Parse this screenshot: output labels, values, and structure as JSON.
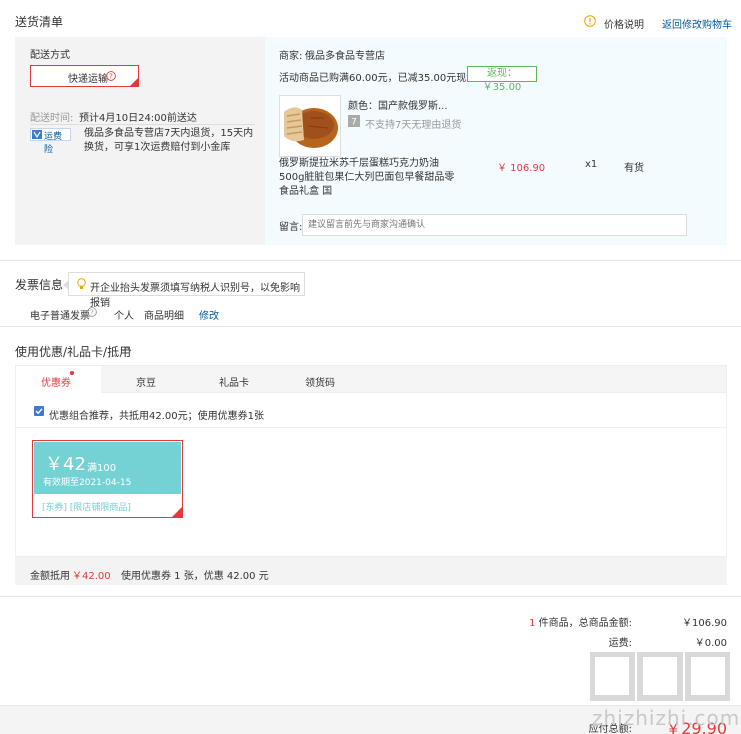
{
  "delivery": {
    "title": "送货清单",
    "price_help": "价格说明",
    "back_cart": "返回修改购物车",
    "method_label": "配送方式",
    "method_value": "快递运输",
    "time_label": "配送时间:",
    "time_value": "预计4月10日24:00前送达",
    "insurance_label": "运费险",
    "insurance_text": "俄品多食品专营店7天内退货，15天内换货，可享1次运费赔付到小金库"
  },
  "shop": {
    "label": "商家:",
    "name": "俄品多食品专营店",
    "promo_text": "活动商品已购满60.00元，已减35.00元现金",
    "promo_badge": "返现：￥35.00",
    "product_color": "颜色：国产款俄罗斯...",
    "no_return": "不支持7天无理由退货",
    "product_title": "俄罗斯提拉米苏千层蛋糕巧克力奶油500g脏脏包果仁大列巴面包早餐甜品零食品礼盒 国",
    "price": "￥ 106.90",
    "qty": "x1",
    "stock": "有货",
    "remark_label": "留言:",
    "remark_placeholder": "建议留言前先与商家沟通确认"
  },
  "invoice": {
    "title": "发票信息",
    "tip": "开企业抬头发票须填写纳税人识别号，以免影响报销",
    "type": "电子普通发票",
    "person": "个人",
    "detail": "商品明细",
    "edit": "修改"
  },
  "coupon": {
    "title": "使用优惠/礼品卡/抵用",
    "tabs": [
      "优惠券",
      "京豆",
      "礼品卡",
      "领货码"
    ],
    "recommend": "优惠组合推荐，共抵用42.00元；使用优惠券1张",
    "amount": "￥42",
    "condition": "满100",
    "expire": "有效期至2021-04-15",
    "tags": "[东券] [限店铺限商品]",
    "summary_label": "金额抵用",
    "summary_value": "￥42.00",
    "summary_detail": "使用优惠券 1 张，优惠 42.00 元"
  },
  "totals": {
    "count": "1",
    "goods_label": "件商品，总商品金额:",
    "goods_value": "￥106.90",
    "shipping_label": "运费:",
    "shipping_value": "￥0.00",
    "payable_label": "应付总额:",
    "payable_value": "￥29.90"
  },
  "watermark": "zhizhizhi.com",
  "colors": {
    "accent": "#e4393c",
    "link": "#005aa0",
    "coupon": "#74d2d4",
    "promo_green": "#5cb85c"
  }
}
